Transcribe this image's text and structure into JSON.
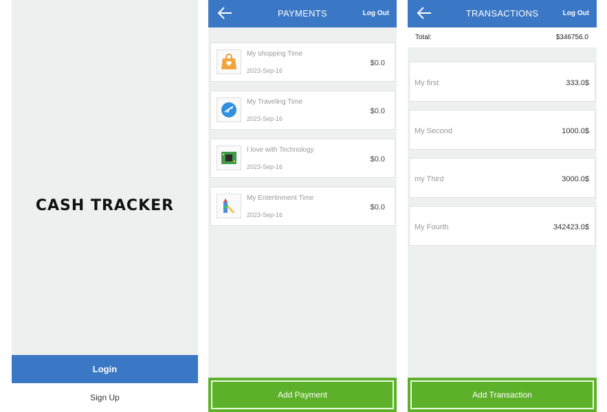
{
  "welcome": {
    "title": "CASH TRACKER",
    "login_label": "Login",
    "signup_label": "Sign Up"
  },
  "payments": {
    "title": "PAYMENTS",
    "logout_label": "Log Out",
    "items": [
      {
        "title": "My shopping Time",
        "date": "2023-Sep-16",
        "amount": "$0.0",
        "icon": "shopping-bag-icon"
      },
      {
        "title": "My Traveling Time",
        "date": "2023-Sep-16",
        "amount": "$0.0",
        "icon": "airplane-icon"
      },
      {
        "title": "I love with Technology",
        "date": "2023-Sep-16",
        "amount": "$0.0",
        "icon": "circuit-board-icon"
      },
      {
        "title": "My Entertinment Time",
        "date": "2023-Sep-16",
        "amount": "$0.0",
        "icon": "playground-icon"
      }
    ],
    "add_label": "Add Payment"
  },
  "transactions": {
    "title": "TRANSACTIONS",
    "logout_label": "Log Out",
    "total_label": "Total:",
    "total_value": "$346756.0",
    "items": [
      {
        "title": "My first",
        "amount": "333.0$"
      },
      {
        "title": "My Second",
        "amount": "1000.0$"
      },
      {
        "title": "my Third",
        "amount": "3000.0$"
      },
      {
        "title": "My Fourth",
        "amount": "342423.0$"
      }
    ],
    "add_label": "Add Transaction"
  },
  "colors": {
    "primary": "#3a77c4",
    "action": "#5db12a",
    "background": "#eeefef"
  }
}
